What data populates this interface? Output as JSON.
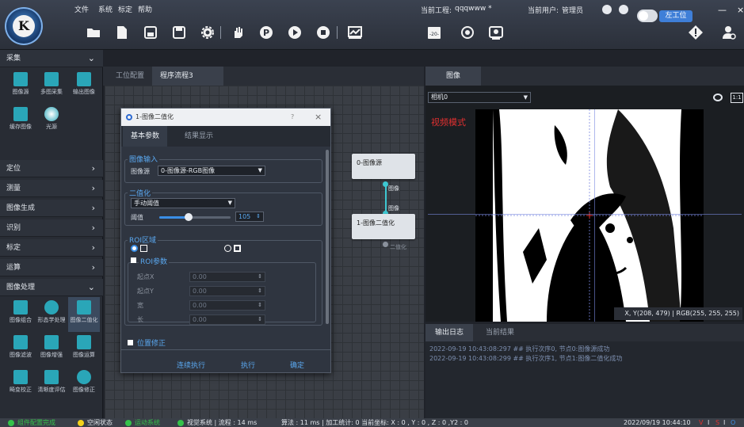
{
  "menu": {
    "file": "文件",
    "system": "系统",
    "calibrate": "标定",
    "help": "帮助"
  },
  "header": {
    "logo_letter": "K",
    "current_project_label": "当前工程:",
    "current_project": "qqqwww *",
    "current_user_label": "当前用户:",
    "current_user": "管理员",
    "station_button": "左工位",
    "minimize": "—",
    "close": "×"
  },
  "toolbar": {
    "icons": [
      "open-folder-icon",
      "new-file-icon",
      "save-icon",
      "save-as-icon",
      "settings-icon",
      "hand-icon",
      "p-circle-icon",
      "play-icon",
      "stop-icon",
      "chart-icon",
      "counter-icon",
      "target-icon",
      "camera-icon",
      "warning-icon",
      "user-settings-icon"
    ],
    "counter_text": "-20-"
  },
  "sidebar": {
    "sections": [
      {
        "label": "采集",
        "expanded": true
      },
      {
        "label": "定位"
      },
      {
        "label": "测量"
      },
      {
        "label": "图像生成"
      },
      {
        "label": "识别"
      },
      {
        "label": "标定"
      },
      {
        "label": "运算"
      },
      {
        "label": "图像处理",
        "expanded": true
      }
    ],
    "acquire_tools": [
      "图像源",
      "多图采集",
      "输出图像",
      "缓存图像",
      "光源"
    ],
    "process_tools": [
      "图像组合",
      "形态学处理",
      "图像二值化",
      "图像滤波",
      "图像增强",
      "图像运算",
      "畸变校正",
      "清晰度评估",
      "图像修正"
    ]
  },
  "workspace": {
    "tabs": [
      "工位配置",
      "程序流程3"
    ],
    "active_tab": "程序流程3",
    "nodes": [
      {
        "title": "0-图像源",
        "port_label": "图像"
      },
      {
        "title": "1-图像二值化",
        "port_label": "图像",
        "out_label": "二值化"
      }
    ]
  },
  "dialog": {
    "title": "1-图像二值化",
    "help": "?",
    "close": "×",
    "tabs": [
      "基本参数",
      "结果显示"
    ],
    "active_tab": "基本参数",
    "input_group": {
      "title": "图像输入",
      "source_label": "图像源",
      "source_value": "0-图像源-RGB图像"
    },
    "binary_group": {
      "title": "二值化",
      "mode": "手动阈值",
      "threshold_label": "阈值",
      "threshold": 105,
      "threshold_max": 255
    },
    "roi_group": {
      "title": "ROI区域",
      "params_title": "ROI参数",
      "fields": [
        {
          "label": "起点X",
          "value": "0.00"
        },
        {
          "label": "起点Y",
          "value": "0.00"
        },
        {
          "label": "宽",
          "value": "0.00"
        },
        {
          "label": "长",
          "value": "0.00"
        }
      ]
    },
    "position_fix": "位置修正",
    "buttons": {
      "continuous": "连续执行",
      "execute": "执行",
      "ok": "确定"
    }
  },
  "image_panel": {
    "tab": "图像",
    "camera": "相机0",
    "mode_text": "视频模式",
    "zoom_text": "1:1",
    "pixel_info": "X, Y(208, 479) | RGB(255, 255, 255)"
  },
  "log_panel": {
    "tabs": [
      "输出日志",
      "当前结果"
    ],
    "active_tab": "输出日志",
    "lines": [
      "2022-09-19 10:43:08:297 ## 执行次序0, 节点0:图像源成功",
      "2022-09-19 10:43:08:299 ## 执行次序1, 节点1:图像二值化成功"
    ]
  },
  "statusbar": {
    "items": [
      {
        "text": "组件配置完成",
        "color": "#35c24a"
      },
      {
        "text": "空闲状态",
        "color": "#f3d21b"
      },
      {
        "text": "运动系统",
        "color": "#35c24a"
      },
      {
        "text": "视觉系统 | 流程 : 14 ms",
        "color": "#35c24a"
      }
    ],
    "metrics": "算法 : 11 ms | 加工统计: 0  当前坐标: X : 0 , Y : 0 , Z : 0 ,Y2 : 0",
    "datetime": "2022/09/19 10:44:10",
    "flags": [
      "V",
      "I",
      "S",
      "I",
      "O"
    ]
  }
}
